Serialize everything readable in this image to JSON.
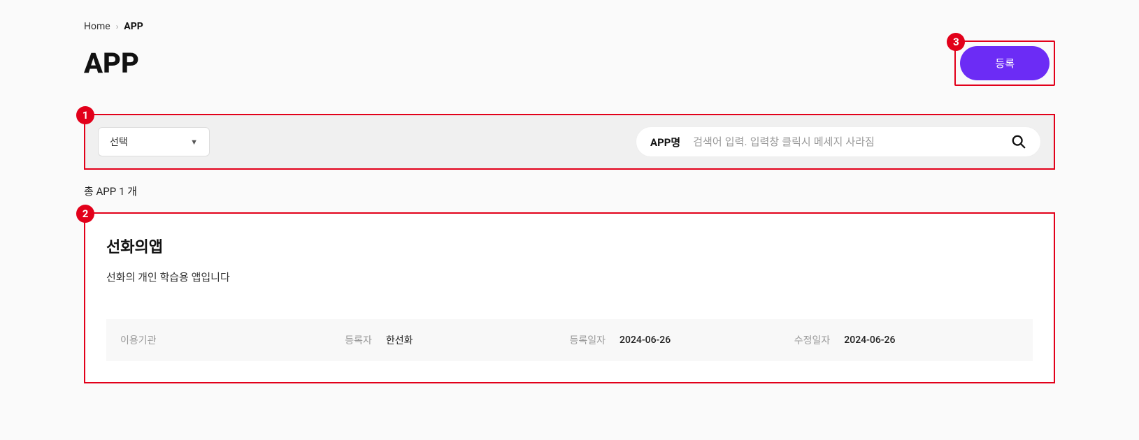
{
  "breadcrumb": {
    "home": "Home",
    "current": "APP"
  },
  "page": {
    "title": "APP",
    "register_label": "등록"
  },
  "callouts": {
    "filter": "1",
    "card": "2",
    "register": "3"
  },
  "filter": {
    "select_label": "선택",
    "search_label": "APP명",
    "search_placeholder": "검색어 입력. 입력창 클릭시 메세지 사라짐"
  },
  "count": {
    "text": "총 APP 1 개"
  },
  "card": {
    "title": "선화의앱",
    "desc": "선화의 개인 학습용 앱입니다",
    "meta": {
      "institution_label": "이용기관",
      "institution_value": "",
      "registrar_label": "등록자",
      "registrar_value": "한선화",
      "created_label": "등록일자",
      "created_value": "2024-06-26",
      "updated_label": "수정일자",
      "updated_value": "2024-06-26"
    }
  }
}
